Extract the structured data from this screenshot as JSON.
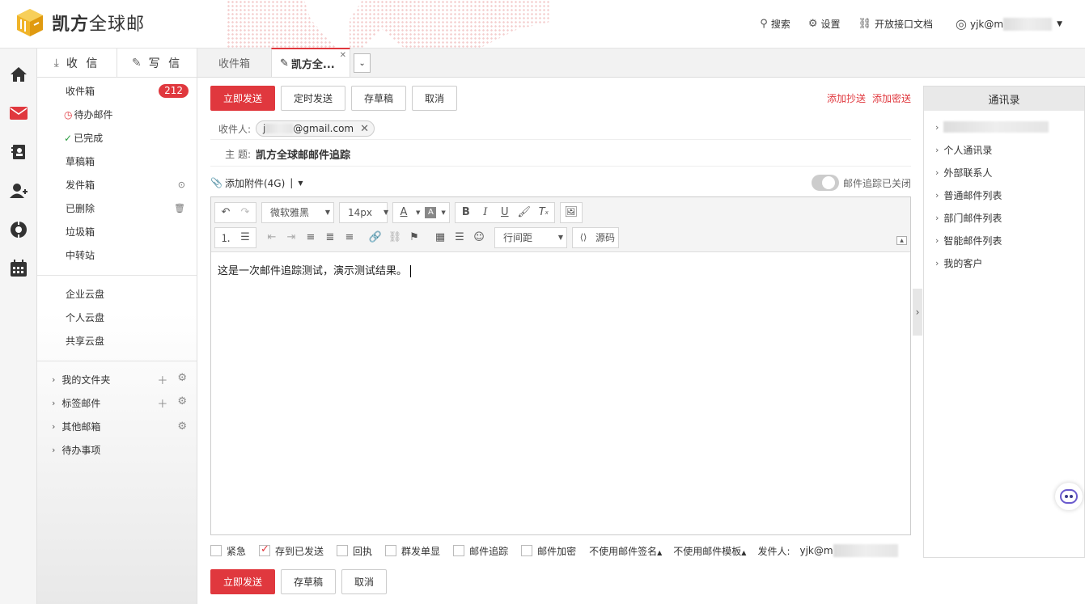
{
  "brand": {
    "name_bold": "凯方",
    "name_rest": "全球邮"
  },
  "topnav": {
    "search": "搜索",
    "settings": "设置",
    "api_docs": "开放接口文档",
    "user": "yjk@m"
  },
  "sidebar": {
    "receive": "收 信",
    "compose": "写 信",
    "folders": [
      {
        "label": "收件箱",
        "badge": "212"
      },
      {
        "label": "待办邮件"
      },
      {
        "label": "已完成"
      },
      {
        "label": "草稿箱"
      },
      {
        "label": "发件箱"
      },
      {
        "label": "已删除"
      },
      {
        "label": "垃圾箱"
      },
      {
        "label": "中转站"
      }
    ],
    "clouds": [
      "企业云盘",
      "个人云盘",
      "共享云盘"
    ],
    "groups": [
      "我的文件夹",
      "标签邮件",
      "其他邮箱",
      "待办事项"
    ]
  },
  "tabs": {
    "inbox": "收件箱",
    "compose": "凯方全..."
  },
  "actions": {
    "send_now": "立即发送",
    "schedule": "定时发送",
    "save_draft": "存草稿",
    "cancel": "取消"
  },
  "add_cc": "添加抄送",
  "add_bcc": "添加密送",
  "recipient": {
    "label": "收件人:",
    "chip_prefix": "j",
    "chip_domain": "@gmail.com"
  },
  "subject": {
    "label": "主  题:",
    "value": "凯方全球邮邮件追踪"
  },
  "attachment": {
    "label": "添加附件(4G)",
    "sep": "|"
  },
  "tracking": {
    "label": "邮件追踪已关闭"
  },
  "editor": {
    "font_family": "微软雅黑",
    "font_size": "14px",
    "line_height": "行间距",
    "source": "源码",
    "content": "这是一次邮件追踪测试，演示测试结果。"
  },
  "options": {
    "urgent": "紧急",
    "save_sent": "存到已发送",
    "receipt": "回执",
    "single_display": "群发单显",
    "mail_track": "邮件追踪",
    "encrypt": "邮件加密",
    "no_signature": "不使用邮件签名",
    "no_template": "不使用邮件模板",
    "sender_label": "发件人:",
    "sender_value": "yjk@m"
  },
  "contacts": {
    "title": "通讯录",
    "items": [
      "个人通讯录",
      "外部联系人",
      "普通邮件列表",
      "部门邮件列表",
      "智能邮件列表",
      "我的客户"
    ]
  },
  "colors": {
    "accent": "#e0383e"
  }
}
